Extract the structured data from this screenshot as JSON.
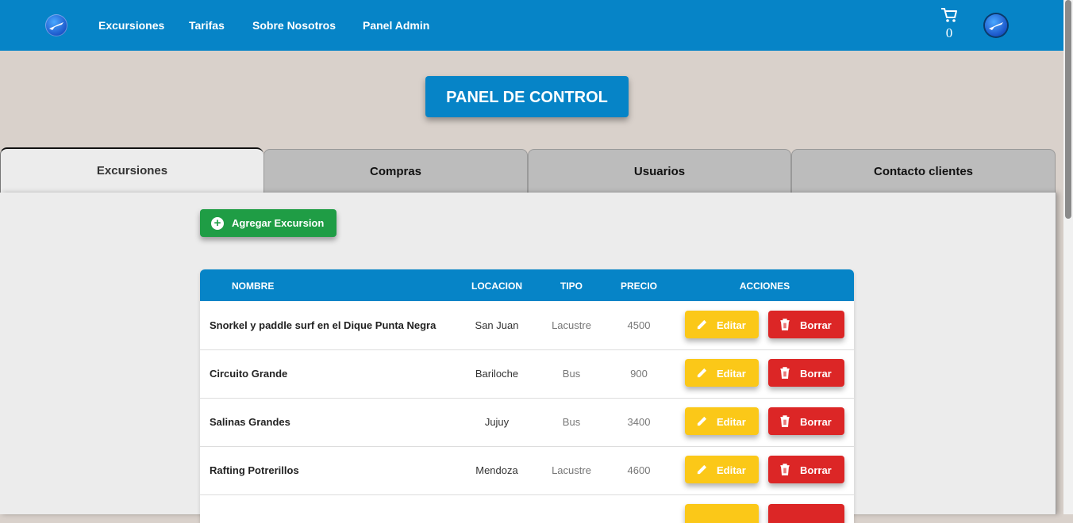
{
  "nav": {
    "links": [
      "Excursiones",
      "Tarifas",
      "Sobre Nosotros",
      "Panel Admin"
    ],
    "cart_count": "0",
    "icons": {
      "logo": "plane-globe-icon",
      "cart": "cart-icon",
      "profile": "profile-globe-icon"
    }
  },
  "page": {
    "title": "PANEL DE CONTROL"
  },
  "tabs": [
    "Excursiones",
    "Compras",
    "Usuarios",
    "Contacto clientes"
  ],
  "active_tab": "Excursiones",
  "add_button": "Agregar Excursion",
  "table": {
    "headers": {
      "name": "NOMBRE",
      "location": "LOCACION",
      "type": "TIPO",
      "price": "PRECIO",
      "actions": "ACCIONES"
    },
    "rows": [
      {
        "name": "Snorkel y paddle surf en el Dique Punta Negra",
        "location": "San Juan",
        "type": "Lacustre",
        "price": "4500"
      },
      {
        "name": "Circuito Grande",
        "location": "Bariloche",
        "type": "Bus",
        "price": "900"
      },
      {
        "name": "Salinas Grandes",
        "location": "Jujuy",
        "type": "Bus",
        "price": "3400"
      },
      {
        "name": "Rafting Potrerillos",
        "location": "Mendoza",
        "type": "Lacustre",
        "price": "4600"
      }
    ],
    "edit_label": "Editar",
    "delete_label": "Borrar"
  },
  "colors": {
    "primary": "#0684c7",
    "success": "#1f9d45",
    "warning": "#fbc818",
    "danger": "#dc2626",
    "background": "#d9d1cb"
  }
}
